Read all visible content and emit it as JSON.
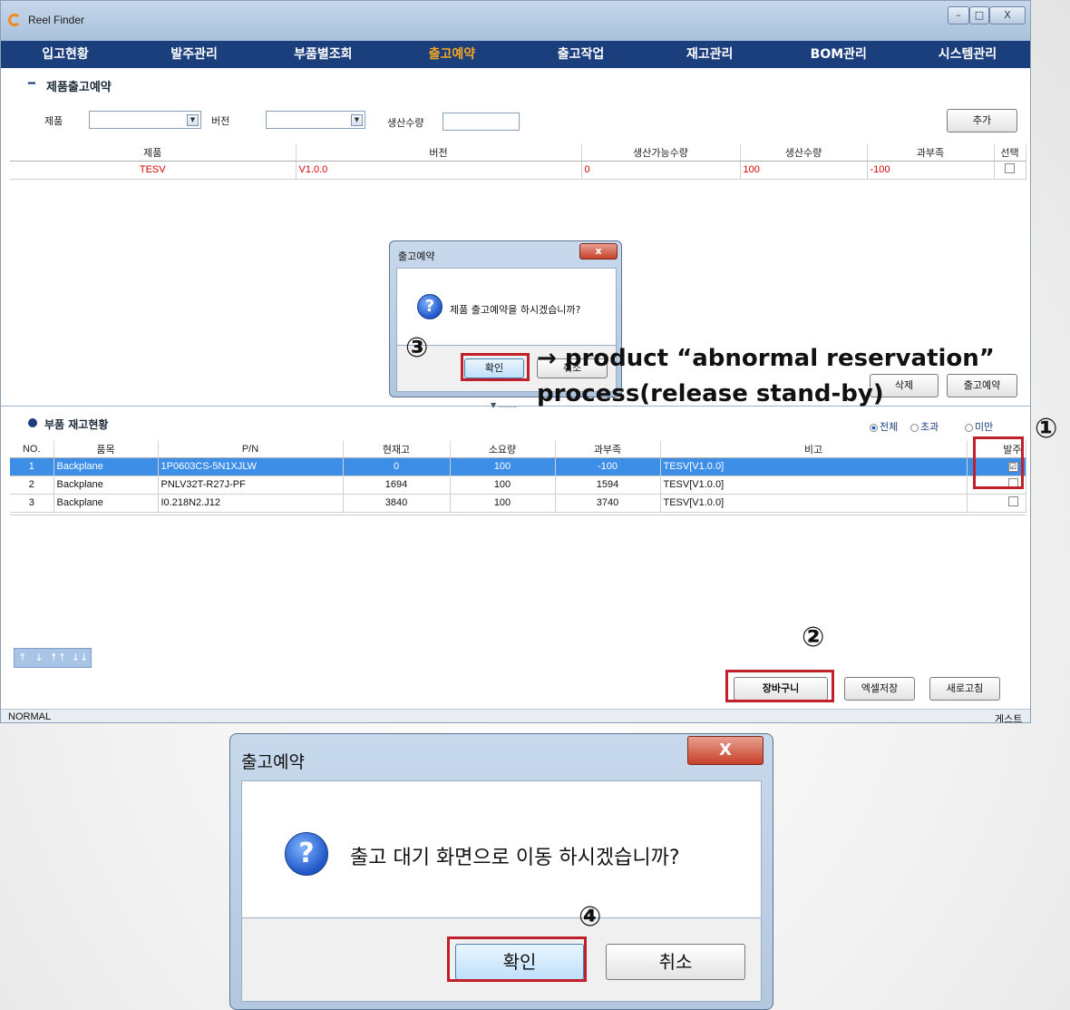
{
  "window": {
    "title": "Reel Finder",
    "minimize_glyph": "–",
    "maximize_glyph": "□",
    "close_glyph": "X"
  },
  "menu": [
    {
      "label": "입고현황"
    },
    {
      "label": "발주관리"
    },
    {
      "label": "부품별조회"
    },
    {
      "label": "출고예약"
    },
    {
      "label": "출고작업"
    },
    {
      "label": "재고관리"
    },
    {
      "label": "BOM관리"
    },
    {
      "label": "시스템관리"
    }
  ],
  "product_section": {
    "collapse_glyph": "━",
    "title": "제품출고예약",
    "product_label": "제품",
    "version_label": "버전",
    "qty_label": "생산수량",
    "add_button": "추가",
    "columns": [
      "제품",
      "버전",
      "생산가능수량",
      "생산수량",
      "과부족",
      "선택"
    ],
    "rows": [
      {
        "product": "TESV",
        "version": "V1.0.0",
        "possible": "0",
        "qty": "100",
        "diff": "-100"
      }
    ],
    "delete_button": "삭제",
    "reserve_button": "출고예약"
  },
  "parts_section": {
    "title": "부품 재고현황",
    "filters": {
      "all": "전체",
      "over": "초과",
      "under": "미만"
    },
    "columns": [
      "NO.",
      "품목",
      "P/N",
      "현재고",
      "소요량",
      "과부족",
      "비고",
      "발주"
    ],
    "rows": [
      {
        "no": "1",
        "item": "Backplane",
        "pn": "1P0603CS-5N1XJLW",
        "stock": "0",
        "need": "100",
        "diff": "-100",
        "note": "TESV[V1.0.0]",
        "checked": "☑"
      },
      {
        "no": "2",
        "item": "Backplane",
        "pn": "PNLV32T-R27J-PF",
        "stock": "1694",
        "need": "100",
        "diff": "1594",
        "note": "TESV[V1.0.0]",
        "checked": ""
      },
      {
        "no": "3",
        "item": "Backplane",
        "pn": "I0.218N2.J12",
        "stock": "3840",
        "need": "100",
        "diff": "3740",
        "note": "TESV[V1.0.0]",
        "checked": ""
      }
    ],
    "nav_buttons": [
      "↑",
      "↓",
      "↑↑",
      "↓↓"
    ],
    "cart_button": "장바구니",
    "excel_button": "엑셀저장",
    "refresh_button": "새로고침"
  },
  "statusbar": {
    "mode": "NORMAL",
    "user": "게스트"
  },
  "dialog_small": {
    "title": "출고예약",
    "message": "제품 출고예약을 하시겠습니까?",
    "ok": "확인",
    "cancel": "취소",
    "close_glyph": "x"
  },
  "dialog_large": {
    "title": "출고예약",
    "message": "출고 대기 화면으로 이동 하시겠습니까?",
    "ok": "확인",
    "cancel": "취소",
    "close_glyph": "X"
  },
  "annotations": {
    "step1": "①",
    "step2": "②",
    "step3": "③",
    "step4": "④",
    "note_line1": "→ product “abnormal reservation”",
    "note_line2": "process(release stand-by)",
    "splitter": "▼ ........"
  },
  "colors": {
    "menu_bg": "#1b3f7d",
    "menu_active": "#f5a623",
    "highlight": "#c0202a",
    "selected_row": "#3d8ee6",
    "negative_text": "#d40000"
  }
}
